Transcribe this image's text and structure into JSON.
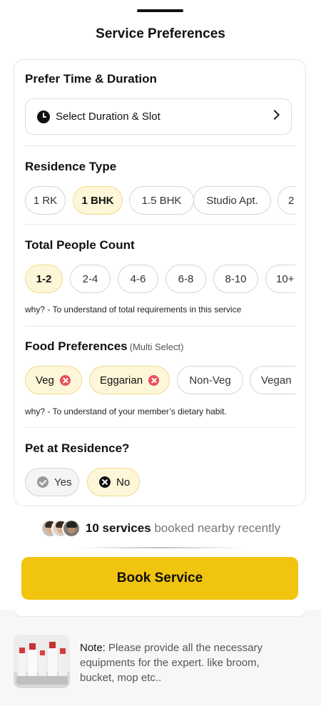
{
  "sheet": {
    "title": "Service Preferences"
  },
  "time": {
    "title": "Prefer Time & Duration",
    "slot_label": "Select Duration & Slot"
  },
  "residence": {
    "title": "Residence Type",
    "options": [
      "1 RK",
      "1 BHK",
      "1.5 BHK",
      "Studio Apt.",
      "2"
    ],
    "selected": "1 BHK"
  },
  "people": {
    "title": "Total People Count",
    "options": [
      "1-2",
      "2-4",
      "4-6",
      "6-8",
      "8-10",
      "10+"
    ],
    "selected": "1-2",
    "why": "why? - To understand of total requirements in this service"
  },
  "food": {
    "title": "Food Preferences",
    "subtitle": "(Multi Select)",
    "options": [
      "Veg",
      "Eggarian",
      "Non-Veg",
      "Vegan"
    ],
    "selected": [
      "Veg",
      "Eggarian"
    ],
    "why": "why? - To understand of your member’s dietary habit."
  },
  "pet": {
    "title": "Pet at Residence?",
    "yes": "Yes",
    "no": "No",
    "selected": "No"
  },
  "social": {
    "count": "10 services",
    "rest": "booked nearby recently"
  },
  "cta": {
    "label": "Book Service",
    "color": "#f1c40f"
  },
  "note": {
    "label": "Note:",
    "text": "Please provide all the necessary equipments for the expert. like broom, bucket, mop etc.."
  }
}
